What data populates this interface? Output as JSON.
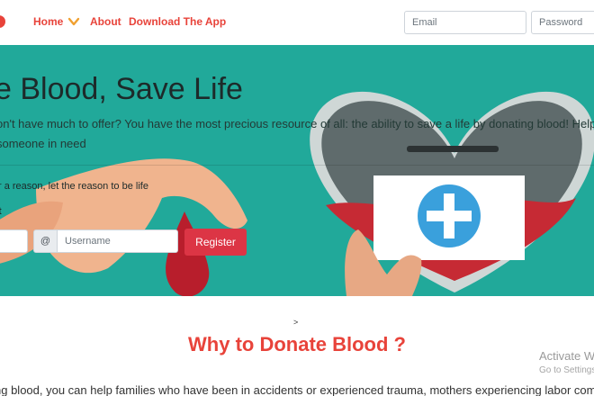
{
  "navbar": {
    "links": {
      "home": "Home",
      "about": "About",
      "download": "Download The App"
    },
    "email_placeholder": "Email",
    "password_placeholder": "Password"
  },
  "hero": {
    "title": "e Blood, Save Life",
    "text": "on't have much to offer? You have the most precious resource of all: the ability to save a life by donating blood! Help a someone in need",
    "quote": "r a reason, let the reason to be life",
    "subheading": "t",
    "at_symbol": "@",
    "username_placeholder": "Username",
    "register_label": "Register"
  },
  "caret": ">",
  "section": {
    "title": "Why to Donate Blood ?",
    "text": "ng blood, you can help families who have been in accidents or experienced trauma, mothers experiencing labor comp"
  },
  "watermark": {
    "title": "Activate W",
    "subtitle": "Go to Settings"
  },
  "colors": {
    "brand_red": "#e8433a",
    "hero_teal": "#21a99a",
    "button_red": "#dc3545"
  }
}
